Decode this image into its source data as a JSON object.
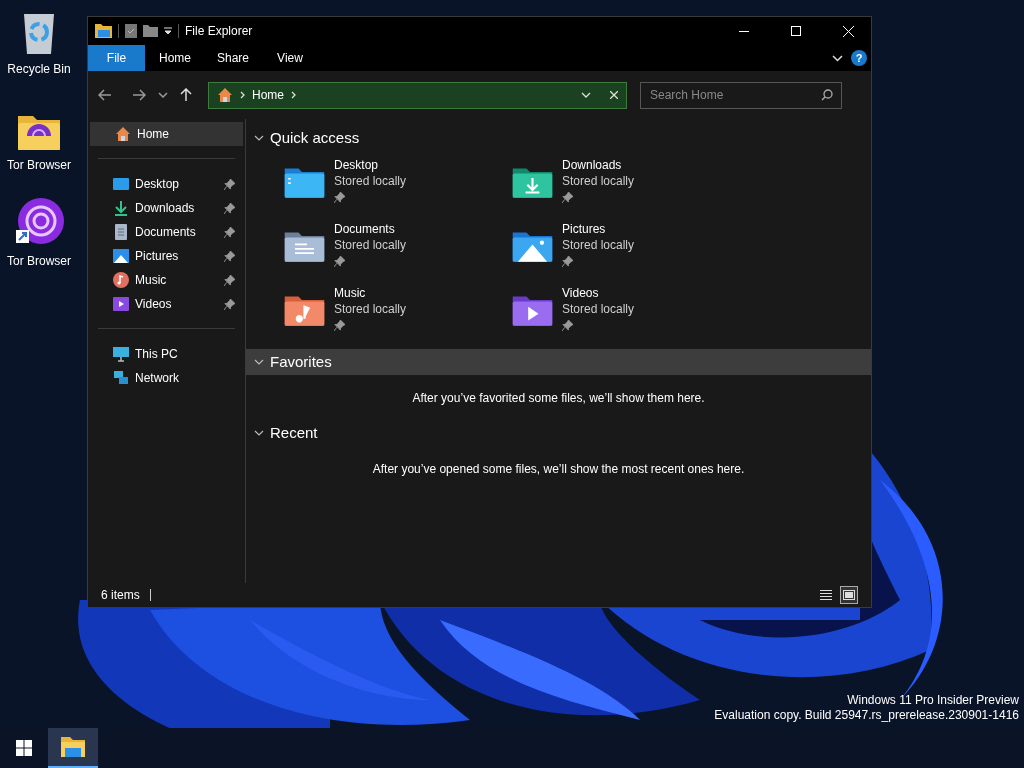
{
  "desktop_icons": [
    {
      "label": "Recycle Bin",
      "kind": "recycle"
    },
    {
      "label": "Tor Browser",
      "kind": "folder"
    },
    {
      "label": "Tor Browser",
      "kind": "tor"
    }
  ],
  "window": {
    "title": "File Explorer",
    "ribbon_tabs": [
      {
        "label": "File",
        "selected": true
      },
      {
        "label": "Home",
        "selected": false
      },
      {
        "label": "Share",
        "selected": false
      },
      {
        "label": "View",
        "selected": false
      }
    ],
    "address": {
      "segments": [
        "Home"
      ]
    },
    "search": {
      "placeholder": "Search Home"
    },
    "help_button": {
      "label": "?"
    },
    "sidebar": {
      "groups": [
        [
          {
            "label": "Home",
            "kind": "home",
            "selected": true,
            "pinned": false
          }
        ],
        [
          {
            "label": "Desktop",
            "kind": "desktop",
            "selected": false,
            "pinned": true
          },
          {
            "label": "Downloads",
            "kind": "downloads",
            "selected": false,
            "pinned": true
          },
          {
            "label": "Documents",
            "kind": "documents",
            "selected": false,
            "pinned": true
          },
          {
            "label": "Pictures",
            "kind": "pictures",
            "selected": false,
            "pinned": true
          },
          {
            "label": "Music",
            "kind": "music",
            "selected": false,
            "pinned": true
          },
          {
            "label": "Videos",
            "kind": "videos",
            "selected": false,
            "pinned": true
          }
        ],
        [
          {
            "label": "This PC",
            "kind": "pc",
            "selected": false,
            "pinned": false
          },
          {
            "label": "Network",
            "kind": "network",
            "selected": false,
            "pinned": false
          }
        ]
      ]
    },
    "sections": [
      {
        "title": "Quick access",
        "highlighted": false,
        "items": [
          {
            "name": "Desktop",
            "status": "Stored locally",
            "kind": "desktop",
            "pinned": true
          },
          {
            "name": "Downloads",
            "status": "Stored locally",
            "kind": "downloads",
            "pinned": true
          },
          {
            "name": "Documents",
            "status": "Stored locally",
            "kind": "documents",
            "pinned": true
          },
          {
            "name": "Pictures",
            "status": "Stored locally",
            "kind": "pictures",
            "pinned": true
          },
          {
            "name": "Music",
            "status": "Stored locally",
            "kind": "music",
            "pinned": true
          },
          {
            "name": "Videos",
            "status": "Stored locally",
            "kind": "videos",
            "pinned": true
          }
        ]
      },
      {
        "title": "Favorites",
        "highlighted": true,
        "message": "After you’ve favorited some files, we’ll show them here."
      },
      {
        "title": "Recent",
        "highlighted": false,
        "message": "After you’ve opened some files, we’ll show the most recent ones here."
      }
    ],
    "status_bar": {
      "item_count": "6 items",
      "views": [
        {
          "kind": "details",
          "selected": false
        },
        {
          "kind": "large",
          "selected": true
        }
      ]
    }
  },
  "watermark": [
    "Windows 11 Pro Insider Preview",
    "Evaluation copy. Build 25947.rs_prerelease.230901-1416"
  ],
  "taskbar": {
    "apps": [
      {
        "kind": "explorer",
        "selected": true
      }
    ]
  }
}
